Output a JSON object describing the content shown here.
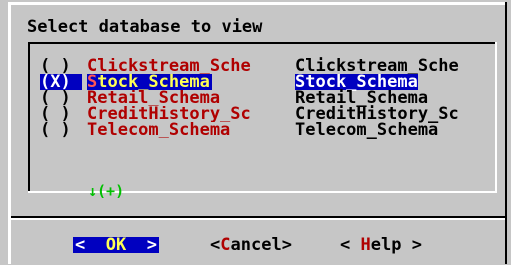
{
  "dialog": {
    "title": "Select database to view"
  },
  "list": {
    "items": [
      {
        "mark": "( )",
        "name": "Clickstream_Sche",
        "desc": "Clickstream_Sche",
        "selected": false
      },
      {
        "mark": "(X)",
        "name": "Stock_Schema",
        "desc": "Stock_Schema",
        "selected": true
      },
      {
        "mark": "( )",
        "name": "Retail_Schema",
        "desc": "Retail_Schema",
        "selected": false
      },
      {
        "mark": "( )",
        "name": "CreditHistory_Sc",
        "desc": "CreditHistory_Sc",
        "selected": false
      },
      {
        "mark": "( )",
        "name": "Telecom_Schema",
        "desc": "Telecom_Schema",
        "selected": false
      }
    ],
    "more_indicator": "↓(+)"
  },
  "buttons": {
    "ok": {
      "open": "<",
      "label": "OK",
      "close": ">"
    },
    "cancel": {
      "open": "<",
      "hotkey": "C",
      "rest": "ancel",
      "close": ">"
    },
    "help": {
      "open": "< ",
      "hotkey": "H",
      "rest": "elp",
      "close": " >"
    }
  },
  "colors": {
    "dialog_bg": "#c6c6c6",
    "selection_bg": "#0000c0",
    "item_text": "#b00000",
    "more_indicator": "#00c000"
  }
}
